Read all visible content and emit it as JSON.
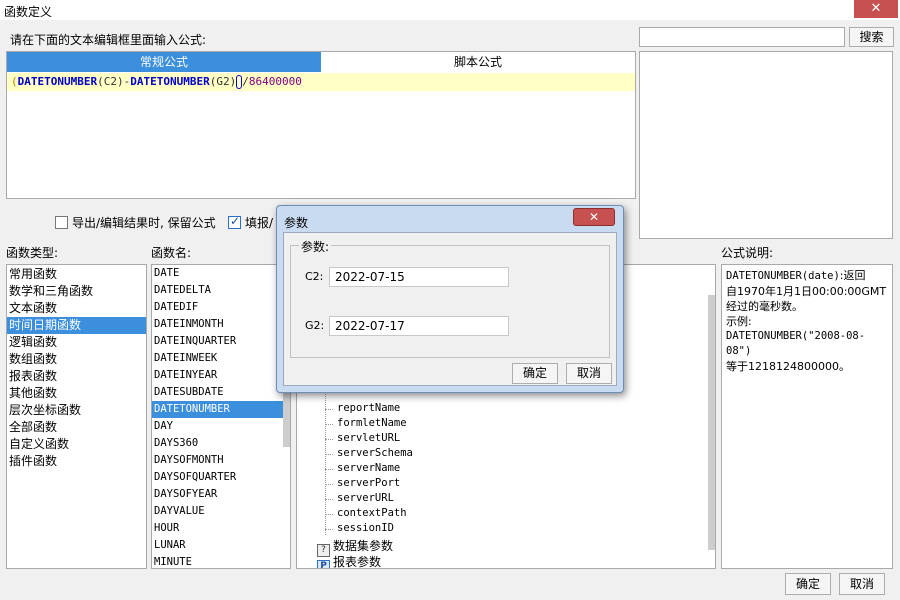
{
  "window": {
    "title": "函数定义",
    "close_icon": "close-icon"
  },
  "editor": {
    "hint": "请在下面的文本编辑框里面输入公式:",
    "tabs": {
      "normal": "常规公式",
      "script": "脚本公式"
    },
    "formula": {
      "p1": "(",
      "fn1": "DATETONUMBER",
      "a1": "(C2)",
      "op": "-",
      "fn2": "DATETONUMBER",
      "a2": "(G2)",
      "slash": "/",
      "num": "86400000"
    }
  },
  "search": {
    "value": "",
    "button": "搜索"
  },
  "options": {
    "keep_formula": {
      "label": "导出/编辑结果时, 保留公式",
      "checked": false
    },
    "fill": {
      "label": "填报/",
      "checked": true
    }
  },
  "categories": {
    "label": "函数类型:",
    "items": [
      "常用函数",
      "数学和三角函数",
      "文本函数",
      "时间日期函数",
      "逻辑函数",
      "数组函数",
      "报表函数",
      "其他函数",
      "层次坐标函数",
      "全部函数",
      "自定义函数",
      "插件函数"
    ],
    "selected": "时间日期函数"
  },
  "functions": {
    "label": "函数名:",
    "items": [
      "DATE",
      "DATEDELTA",
      "DATEDIF",
      "DATEINMONTH",
      "DATEINQUARTER",
      "DATEINWEEK",
      "DATEINYEAR",
      "DATESUBDATE",
      "DATETONUMBER",
      "DAY",
      "DAYS360",
      "DAYSOFMONTH",
      "DAYSOFQUARTER",
      "DAYSOFYEAR",
      "DAYVALUE",
      "HOUR",
      "LUNAR",
      "MINUTE"
    ],
    "selected": "DATETONUMBER"
  },
  "params_tree": {
    "items": [
      "reportName",
      "formletName",
      "servletURL",
      "serverSchema",
      "serverName",
      "serverPort",
      "serverURL",
      "contextPath",
      "sessionID"
    ],
    "groups": {
      "dataset": "数据集参数",
      "report": "报表参数"
    }
  },
  "description": {
    "label": "公式说明:",
    "fn_sig": "DATETONUMBER(date)",
    "line1_rest": ":返回",
    "line2": "自1970年1月1日00:00:00GMT经过的毫秒数。",
    "line3": "示例:",
    "example_code": "DATETONUMBER(\"2008-08-08\")",
    "example_result": "等于1218124800000。"
  },
  "footer": {
    "ok": "确定",
    "cancel": "取消"
  },
  "modal": {
    "title": "参数",
    "legend": "参数:",
    "params": [
      {
        "label": "C2:",
        "value": "2022-07-15"
      },
      {
        "label": "G2:",
        "value": "2022-07-17"
      }
    ],
    "ok": "确定",
    "cancel": "取消"
  }
}
